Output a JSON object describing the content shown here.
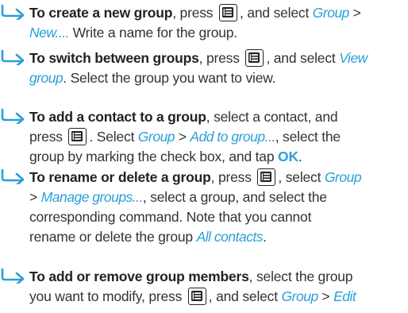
{
  "items": [
    {
      "lines": [
        [
          {
            "t": "bold",
            "v": "To create a new group"
          },
          {
            "t": "text",
            "v": ", press "
          },
          {
            "t": "icon"
          },
          {
            "t": "text",
            "v": ", and select "
          },
          {
            "t": "cmd",
            "v": "Group"
          },
          {
            "t": "text",
            "v": " >"
          }
        ],
        [
          {
            "t": "cmd",
            "v": "New...."
          },
          {
            "t": "text",
            "v": " Write a name for the group."
          }
        ]
      ]
    },
    {
      "lines": [
        [
          {
            "t": "bold",
            "v": "To switch between groups"
          },
          {
            "t": "text",
            "v": ", press "
          },
          {
            "t": "icon"
          },
          {
            "t": "text",
            "v": ", and select "
          },
          {
            "t": "cmd",
            "v": "View"
          }
        ],
        [
          {
            "t": "cmd",
            "v": "group"
          },
          {
            "t": "text",
            "v": ". Select the group you want to view."
          }
        ]
      ]
    },
    {
      "lines": [
        [
          {
            "t": "bold",
            "v": "To add a contact to a group"
          },
          {
            "t": "text",
            "v": ", select a contact, and"
          }
        ],
        [
          {
            "t": "text",
            "v": "press "
          },
          {
            "t": "icon"
          },
          {
            "t": "text",
            "v": ". Select "
          },
          {
            "t": "cmd",
            "v": "Group"
          },
          {
            "t": "text",
            "v": " > "
          },
          {
            "t": "cmd",
            "v": "Add to group..."
          },
          {
            "t": "text",
            "v": ", select the"
          }
        ],
        [
          {
            "t": "text",
            "v": "group by marking the check box, and tap "
          },
          {
            "t": "btn",
            "v": "OK"
          },
          {
            "t": "text",
            "v": "."
          }
        ]
      ]
    },
    {
      "lines": [
        [
          {
            "t": "bold",
            "v": "To rename or delete a group"
          },
          {
            "t": "text",
            "v": ", press "
          },
          {
            "t": "icon"
          },
          {
            "t": "text",
            "v": ", select "
          },
          {
            "t": "cmd",
            "v": "Group"
          }
        ],
        [
          {
            "t": "text",
            "v": "> "
          },
          {
            "t": "cmd",
            "v": "Manage groups..."
          },
          {
            "t": "text",
            "v": ", select a group, and select the"
          }
        ],
        [
          {
            "t": "text",
            "v": "corresponding command. Note that you cannot"
          }
        ],
        [
          {
            "t": "text",
            "v": "rename or delete the group "
          },
          {
            "t": "cmd",
            "v": "All contacts"
          },
          {
            "t": "text",
            "v": "."
          }
        ]
      ]
    },
    {
      "lines": [
        [
          {
            "t": "bold",
            "v": "To add or remove group members"
          },
          {
            "t": "text",
            "v": ", select the group"
          }
        ],
        [
          {
            "t": "text",
            "v": "you want to modify, press "
          },
          {
            "t": "icon"
          },
          {
            "t": "text",
            "v": ", and select "
          },
          {
            "t": "cmd",
            "v": "Group"
          },
          {
            "t": "text",
            "v": " > "
          },
          {
            "t": "cmd",
            "v": "Edit"
          }
        ]
      ]
    }
  ],
  "colors": {
    "accent": "#2a9fd8",
    "text": "#333333",
    "arrow": "#2a9fd8"
  },
  "icons": {
    "arrow": "right-arrow-icon",
    "menu": "menu-key-icon"
  }
}
